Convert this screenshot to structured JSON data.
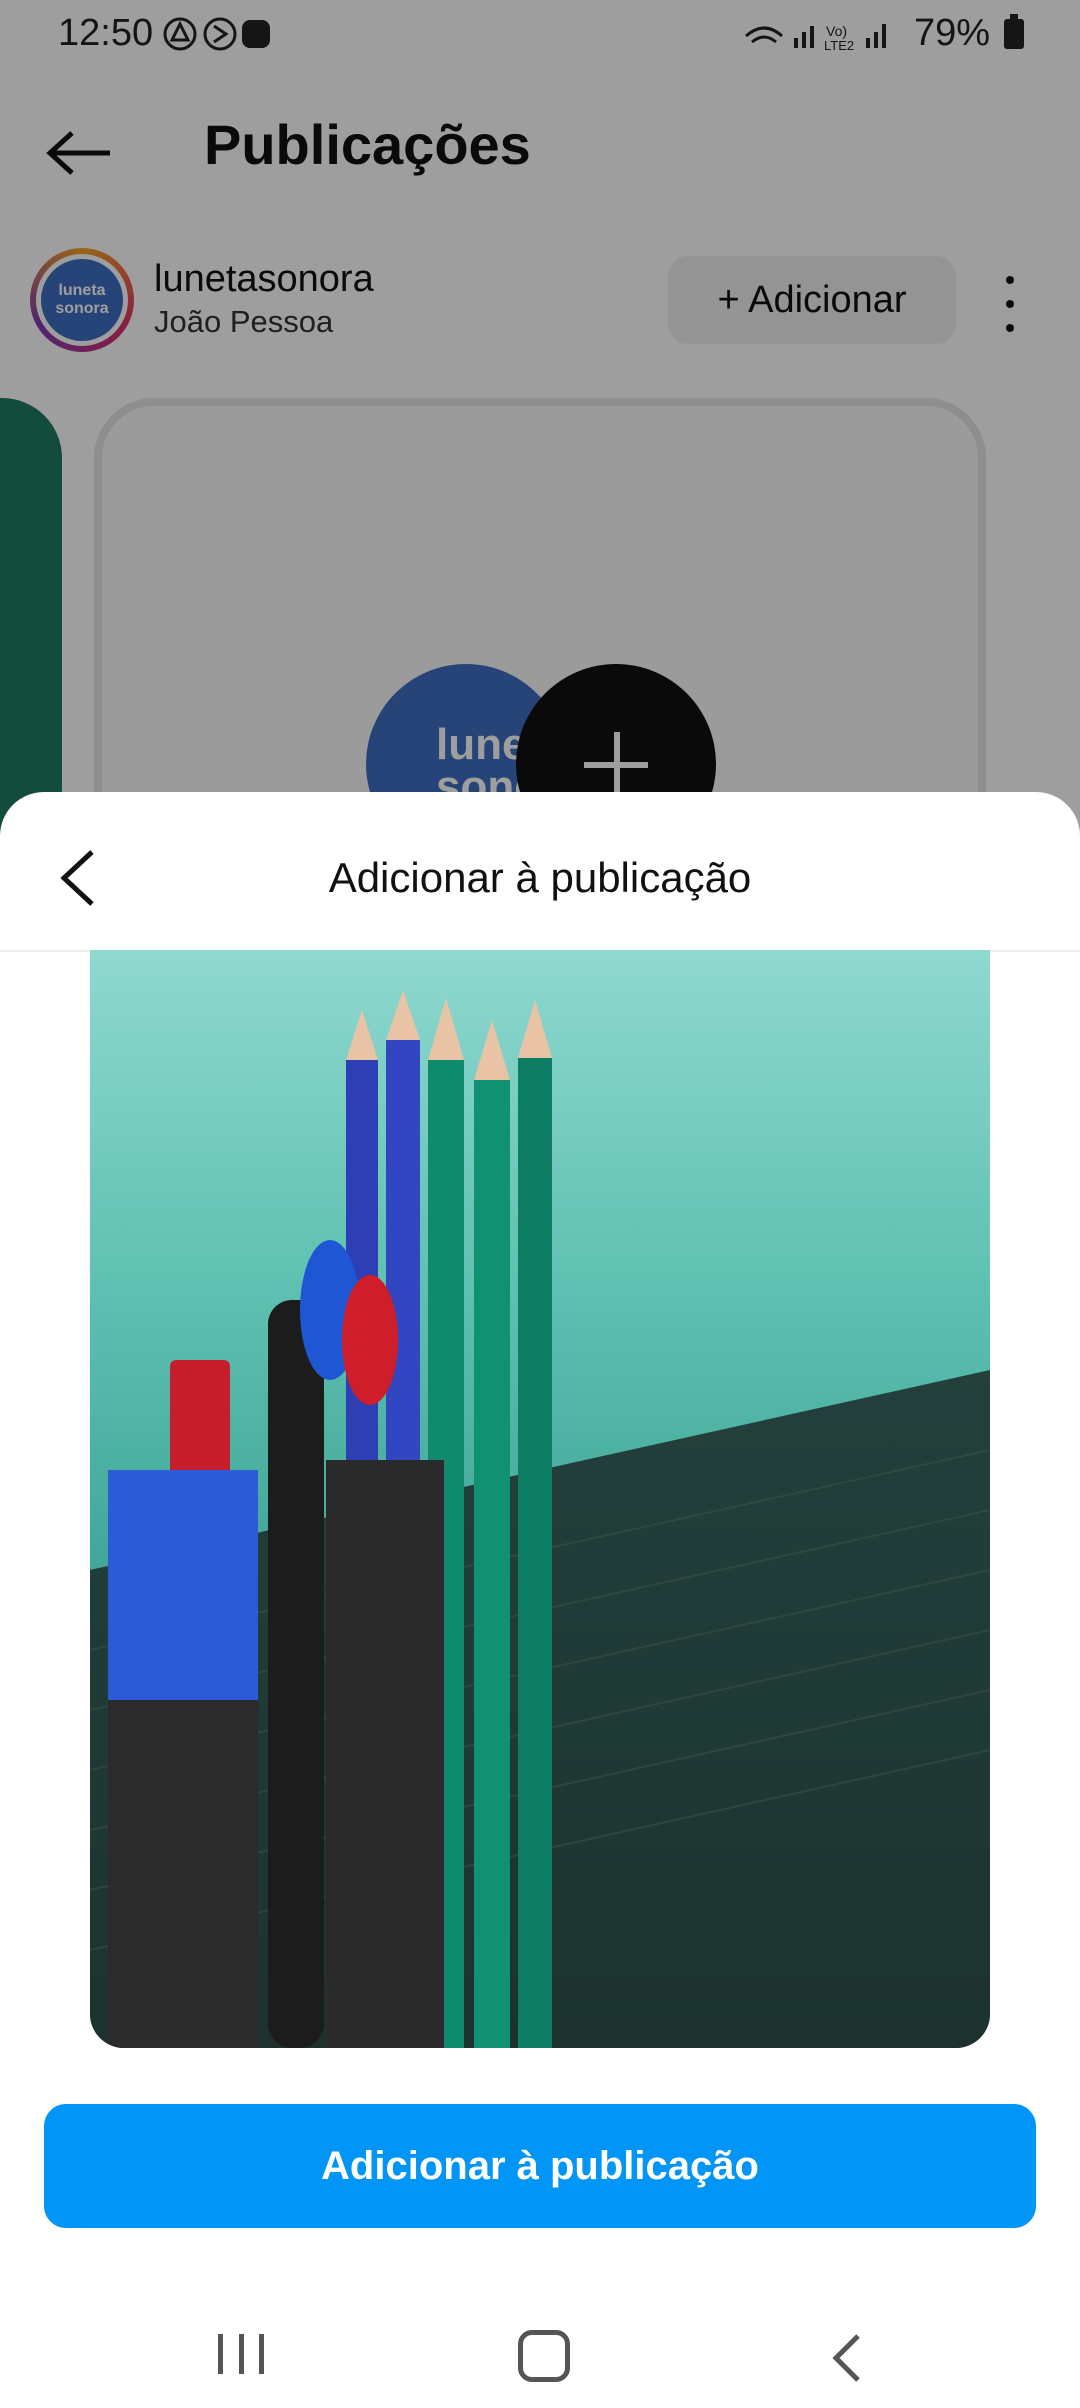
{
  "status_bar": {
    "time": "12:50",
    "battery_percent": "79%"
  },
  "header": {
    "title": "Publicações"
  },
  "profile": {
    "username": "lunetasonora",
    "location": "João Pessoa",
    "add_button_label": "+ Adicionar",
    "avatar_text": "luneta sonora"
  },
  "background": {
    "card_logo_text": "luneta sonora"
  },
  "sheet": {
    "title": "Adicionar à publicação",
    "cta_label": "Adicionar à publicação"
  },
  "colors": {
    "accent": "#0095f6",
    "dim_overlay": "rgba(0,0,0,0.38)",
    "card_green": "#1f7a63",
    "logo_blue": "#3e6fc2"
  },
  "icons": [
    "back-arrow-icon",
    "kebab-icon",
    "plus-icon",
    "chevron-left-icon",
    "recent-apps-icon",
    "home-icon",
    "nav-back-icon"
  ]
}
